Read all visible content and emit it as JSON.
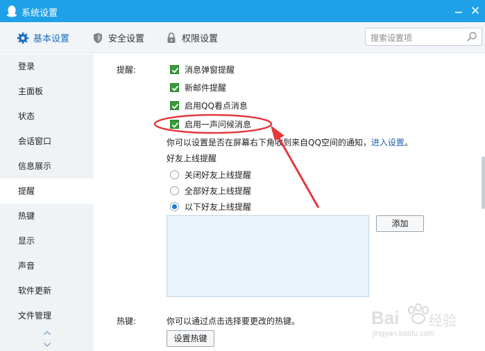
{
  "window": {
    "title": "系统设置",
    "minimize_icon": "minimize-icon",
    "close_icon": "close-icon",
    "accent": "#1ea1e9"
  },
  "tabs": [
    {
      "label": "基本设置",
      "icon": "gear-icon",
      "active": true
    },
    {
      "label": "安全设置",
      "icon": "shield-icon",
      "active": false
    },
    {
      "label": "权限设置",
      "icon": "lock-icon",
      "active": false
    }
  ],
  "search": {
    "placeholder": "搜索设置项",
    "icon": "search-icon"
  },
  "sidebar": {
    "items": [
      {
        "label": "登录"
      },
      {
        "label": "主面板"
      },
      {
        "label": "状态"
      },
      {
        "label": "会话窗口"
      },
      {
        "label": "信息展示"
      },
      {
        "label": "提醒",
        "active": true
      },
      {
        "label": "热键"
      },
      {
        "label": "显示"
      },
      {
        "label": "声音"
      },
      {
        "label": "软件更新"
      },
      {
        "label": "文件管理"
      }
    ]
  },
  "reminder": {
    "section_label": "提醒:",
    "checkboxes": [
      {
        "label": "消息弹窗提醒",
        "checked": true
      },
      {
        "label": "新邮件提醒",
        "checked": true
      },
      {
        "label": "启用QQ看点消息",
        "checked": true
      },
      {
        "label": "启用一声问候消息",
        "checked": true
      }
    ],
    "hint_text": "你可以设置是否在屏幕右下角收到来自QQ空间的通知，",
    "hint_link": "进入设置",
    "hint_end": "。",
    "friend_online_title": "好友上线提醒",
    "radios": [
      {
        "label": "关闭好友上线提醒",
        "selected": false
      },
      {
        "label": "全部好友上线提醒",
        "selected": false
      },
      {
        "label": "以下好友上线提醒",
        "selected": true
      }
    ],
    "add_button": "添加"
  },
  "hotkey": {
    "section_label": "热键:",
    "hint_text": "你可以通过点击选择要更改的热键。",
    "button": "设置热键"
  },
  "colors": {
    "checkbox_green": "#3a9b3a",
    "link_blue": "#1a5fb4",
    "annotation_red": "#e5383b",
    "friend_box_bg": "#eaf4fa"
  },
  "watermark": {
    "brand": "Bai",
    "brand_suffix": "经验",
    "url": "jingyan.baidu.com"
  }
}
